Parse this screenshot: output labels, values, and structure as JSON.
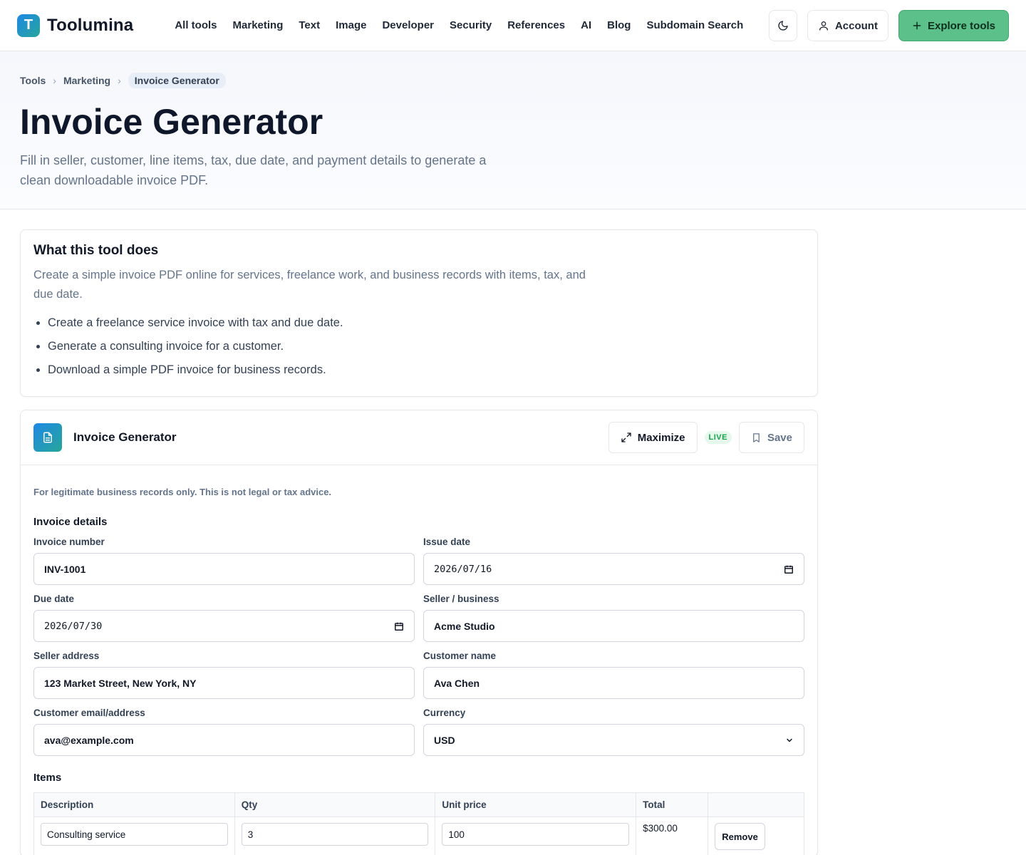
{
  "brand": {
    "logo_letter": "T",
    "name": "Toolumina"
  },
  "nav": [
    "All tools",
    "Marketing",
    "Text",
    "Image",
    "Developer",
    "Security",
    "References",
    "AI",
    "Blog",
    "Subdomain Search"
  ],
  "header": {
    "account_label": "Account",
    "explore_label": "Explore tools",
    "theme_icon": "moon-icon"
  },
  "breadcrumb": {
    "items": [
      "Tools",
      "Marketing"
    ],
    "current": "Invoice Generator"
  },
  "page": {
    "title": "Invoice Generator",
    "subtitle": "Fill in seller, customer, line items, tax, due date, and payment details to generate a clean downloadable invoice PDF."
  },
  "about": {
    "heading": "What this tool does",
    "description": "Create a simple invoice PDF online for services, freelance work, and business records with items, tax, and due date.",
    "bullets": [
      "Create a freelance service invoice with tax and due date.",
      "Generate a consulting invoice for a customer.",
      "Download a simple PDF invoice for business records."
    ]
  },
  "tool": {
    "name": "Invoice Generator",
    "maximize_label": "Maximize",
    "live_badge": "LIVE",
    "save_label": "Save",
    "disclaimer": "For legitimate business records only. This is not legal or tax advice.",
    "details_heading": "Invoice details",
    "fields": {
      "invoice_number": {
        "label": "Invoice number",
        "value": "INV-1001"
      },
      "issue_date": {
        "label": "Issue date",
        "value": "2026/07/16"
      },
      "due_date": {
        "label": "Due date",
        "value": "2026/07/30"
      },
      "seller": {
        "label": "Seller / business",
        "value": "Acme Studio"
      },
      "seller_address": {
        "label": "Seller address",
        "value": "123 Market Street, New York, NY"
      },
      "customer_name": {
        "label": "Customer name",
        "value": "Ava Chen"
      },
      "customer_email": {
        "label": "Customer email/address",
        "value": "ava@example.com"
      },
      "currency": {
        "label": "Currency",
        "value": "USD"
      }
    },
    "items_heading": "Items",
    "items_columns": [
      "Description",
      "Qty",
      "Unit price",
      "Total",
      ""
    ],
    "items": [
      {
        "description": "Consulting service",
        "qty": "3",
        "unit_price": "100",
        "total": "$300.00",
        "remove_label": "Remove"
      }
    ]
  },
  "colors": {
    "accent_green": "#5cc08b",
    "brand_gradient_start": "#1e88e5",
    "brand_gradient_end": "#26a69a",
    "live_green": "#16a34a"
  }
}
